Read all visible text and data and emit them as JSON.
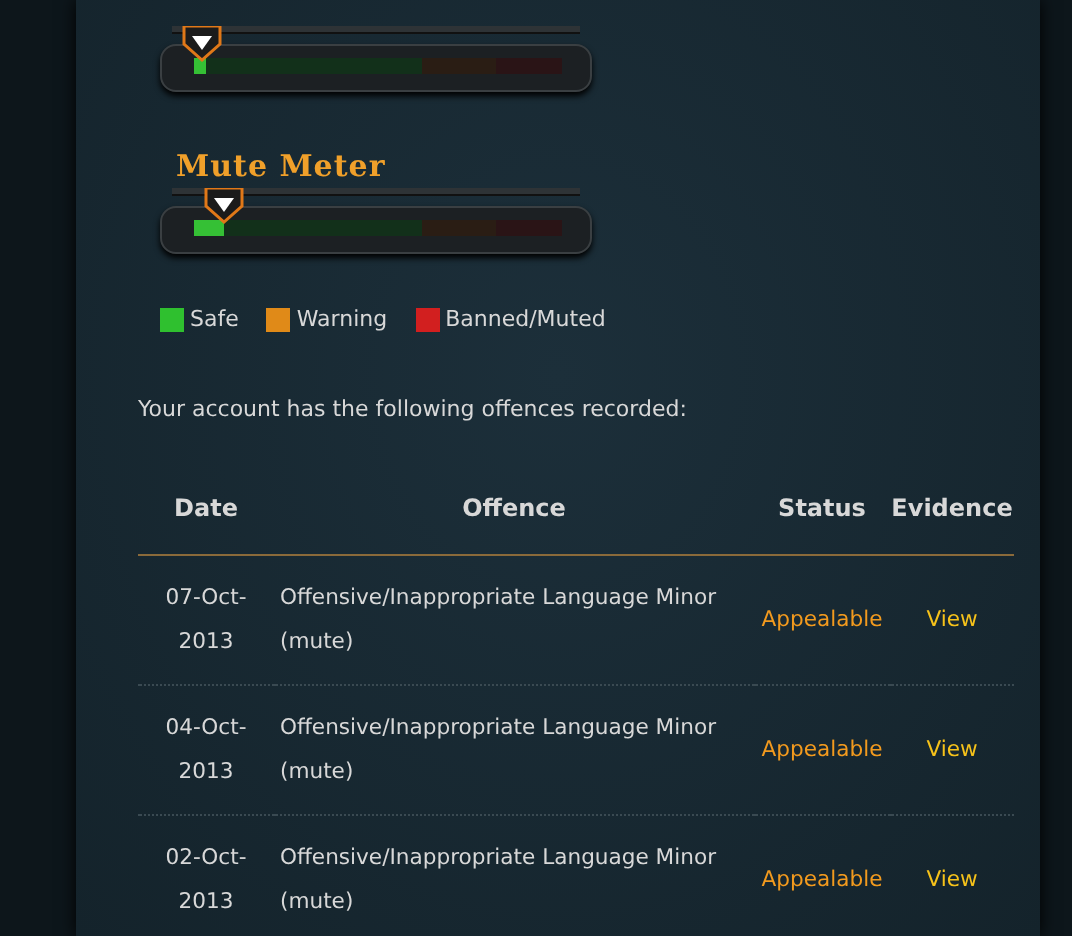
{
  "meters": [
    {
      "level": 0.02
    },
    {
      "title": "Mute Meter",
      "level": 0.08
    }
  ],
  "legend": [
    {
      "label": "Safe",
      "color": "#2fc02f"
    },
    {
      "label": "Warning",
      "color": "#e08a18"
    },
    {
      "label": "Banned/Muted",
      "color": "#d21f1f"
    }
  ],
  "intro": "Your account has the following offences recorded:",
  "table": {
    "columns": [
      "Date",
      "Offence",
      "Status",
      "Evidence"
    ],
    "rows": [
      {
        "date": "07-Oct-2013",
        "offence": "Offensive/Inappropriate Language Minor (mute)",
        "status": "Appealable",
        "evidence": "View"
      },
      {
        "date": "04-Oct-2013",
        "offence": "Offensive/Inappropriate Language Minor (mute)",
        "status": "Appealable",
        "evidence": "View"
      },
      {
        "date": "02-Oct-2013",
        "offence": "Offensive/Inappropriate Language Minor (mute)",
        "status": "Appealable",
        "evidence": "View"
      }
    ]
  }
}
